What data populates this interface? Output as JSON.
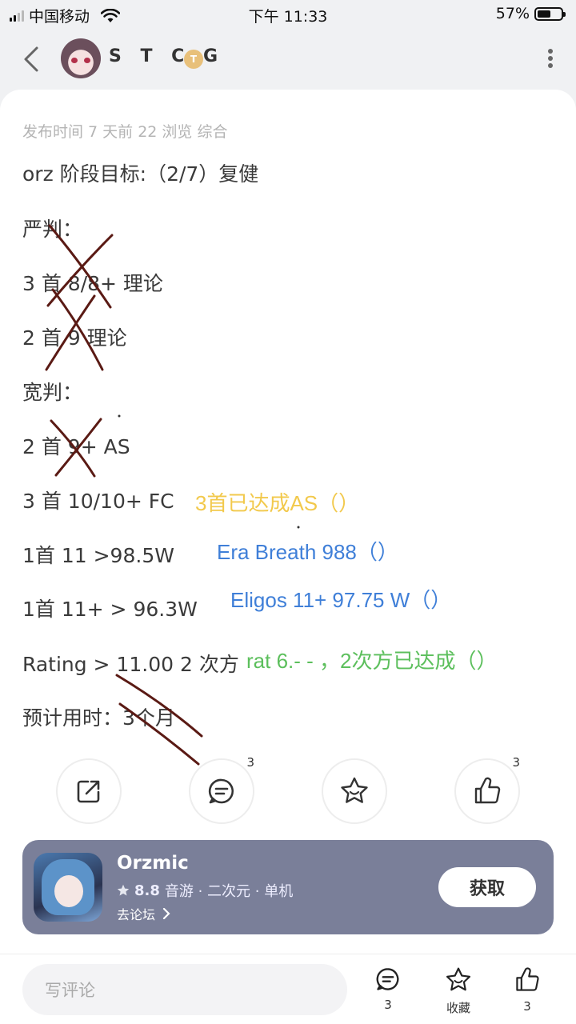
{
  "status_bar": {
    "carrier": "中国移动",
    "time": "下午 11:33",
    "battery": "57%",
    "battery_level": 0.57
  },
  "header": {
    "username": "S T C G",
    "badge": "T"
  },
  "post": {
    "meta": "发布时间 7 天前   22 浏览   综合",
    "lines": [
      "orz 阶段目标:（2/7）复健",
      "严判：",
      "3 首 8/8+ 理论",
      "2 首 9 理论",
      "宽判：",
      "2 首 9+ AS",
      "3 首 10/10+ FC",
      "1首 11 >98.5W",
      "1首 11+ > 96.3W",
      "Rating > 11.00 2 次方",
      "预计用时：3个月"
    ],
    "annotations": {
      "yellow": "3首已达成AS（）",
      "blue1": "Era Breath 988（）",
      "blue2": "Eligos 11+ 97.75 W（）",
      "green": "rat 6.- - ，2次方已达成（）"
    }
  },
  "actions": {
    "share_icon": "share-icon",
    "comment_count": "3",
    "favorite_icon": "star-face-icon",
    "like_count": "3"
  },
  "app_banner": {
    "name": "Orzmic",
    "rating": "8.8",
    "tags": "音游 · 二次元 · 单机",
    "forum_link": "去论坛",
    "get_label": "获取"
  },
  "bottom_bar": {
    "comment_placeholder": "写评论",
    "comment_count": "3",
    "favorite_label": "收藏",
    "like_count": "3"
  }
}
